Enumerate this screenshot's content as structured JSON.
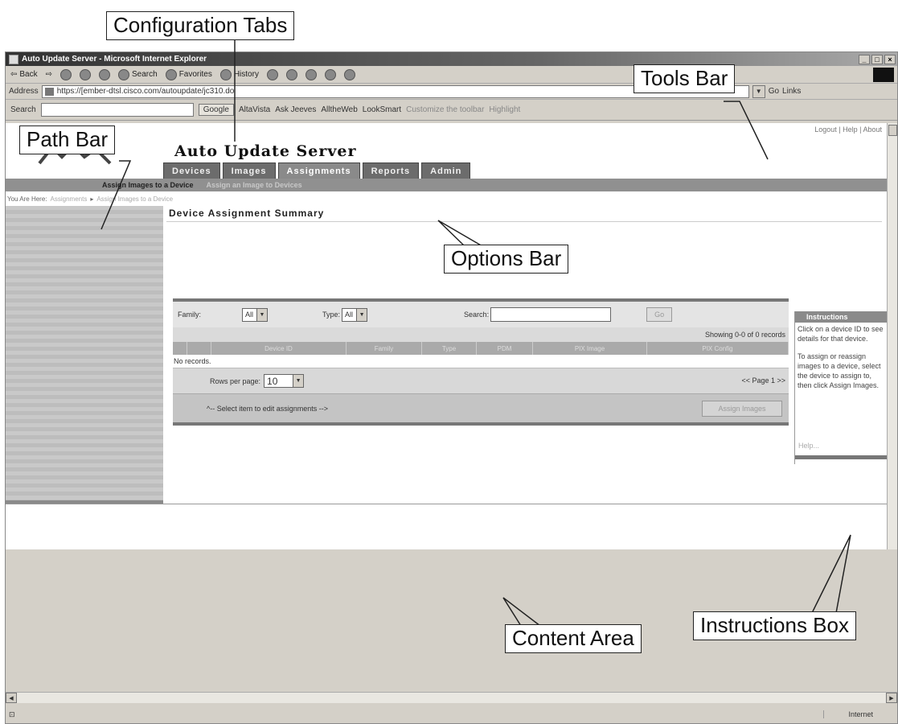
{
  "callouts": {
    "configuration_tabs": "Configuration Tabs",
    "tools_bar": "Tools Bar",
    "path_bar": "Path Bar",
    "options_bar": "Options Bar",
    "instructions_box": "Instructions Box",
    "content_area": "Content Area"
  },
  "browser": {
    "title": "Auto Update Server - Microsoft Internet Explorer",
    "toolbar": {
      "back": "Back",
      "search": "Search",
      "favorites": "Favorites",
      "history": "History"
    },
    "address_label": "Address",
    "address_value": "https://[ember-dtsl.cisco.com/autoupdate/jc310.do",
    "go": "Go",
    "links": "Links",
    "google": {
      "search_label": "Search",
      "google_btn": "Google",
      "items": [
        "AltaVista",
        "Ask Jeeves",
        "AlltheWeb",
        "LookSmart"
      ],
      "customize": "Customize the toolbar",
      "highlight": "Highlight"
    },
    "status_zone": "Internet"
  },
  "page": {
    "top_links": "Logout | Help | About",
    "app_title": "Auto Update Server",
    "tabs": [
      {
        "label": "Devices",
        "active": false
      },
      {
        "label": "Images",
        "active": false
      },
      {
        "label": "Assignments",
        "active": true
      },
      {
        "label": "Reports",
        "active": false
      },
      {
        "label": "Admin",
        "active": false
      }
    ],
    "options": [
      "Assign Images to a Device",
      "Assign an Image to Devices"
    ],
    "path": {
      "prefix": "You Are Here:",
      "items": [
        "Assignments",
        "Assign Images to a Device"
      ]
    },
    "section_title": "Device Assignment Summary",
    "filters": {
      "family_label": "Family:",
      "family_value": "All",
      "type_label": "Type:",
      "type_value": "All",
      "search_label": "Search:",
      "search_value": "",
      "go_label": "Go"
    },
    "showing": "Showing 0-0 of 0 records",
    "columns": [
      "Device ID",
      "Family",
      "Type",
      "PDM",
      "PIX Image",
      "PIX Config"
    ],
    "no_records": "No records.",
    "rows_per_page_label": "Rows per page:",
    "rows_per_page_value": "10",
    "pager": "<< Page 1 >>",
    "select_hint": "^-- Select item to edit assignments -->",
    "assign_btn": "Assign Images",
    "instructions": {
      "title": "Instructions",
      "p1": "Click on a device ID to see details for that device.",
      "p2": "To assign or reassign images to a device, select the device to assign to, then click Assign Images.",
      "help": "Help..."
    }
  }
}
